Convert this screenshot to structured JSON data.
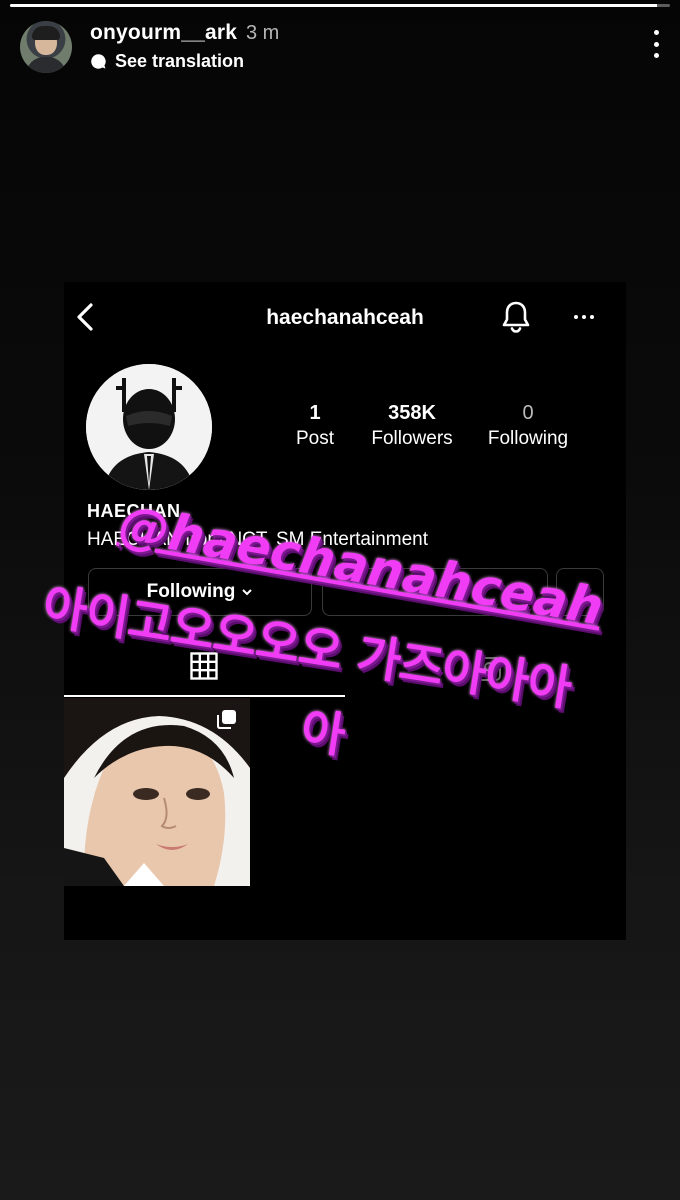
{
  "story": {
    "progress_fraction": 0.98,
    "username": "onyourm__ark",
    "time": "3 m",
    "translation_label": "See translation"
  },
  "embedded_profile": {
    "username": "haechanahceah",
    "stats": {
      "posts_value": "1",
      "posts_label": "Post",
      "followers_value": "358K",
      "followers_label": "Followers",
      "following_value": "0",
      "following_label": "Following"
    },
    "display_name": "HAECHAN",
    "bio": "HAECHAN from NCT, SM Entertainment",
    "following_button": "Following"
  },
  "overlay": {
    "handle": "@haechanahceah",
    "line1": "아이고오오오오 가즈아아아",
    "line2": "아"
  },
  "colors": {
    "overlay_pink": "#f03cf5",
    "background": "#000000"
  }
}
